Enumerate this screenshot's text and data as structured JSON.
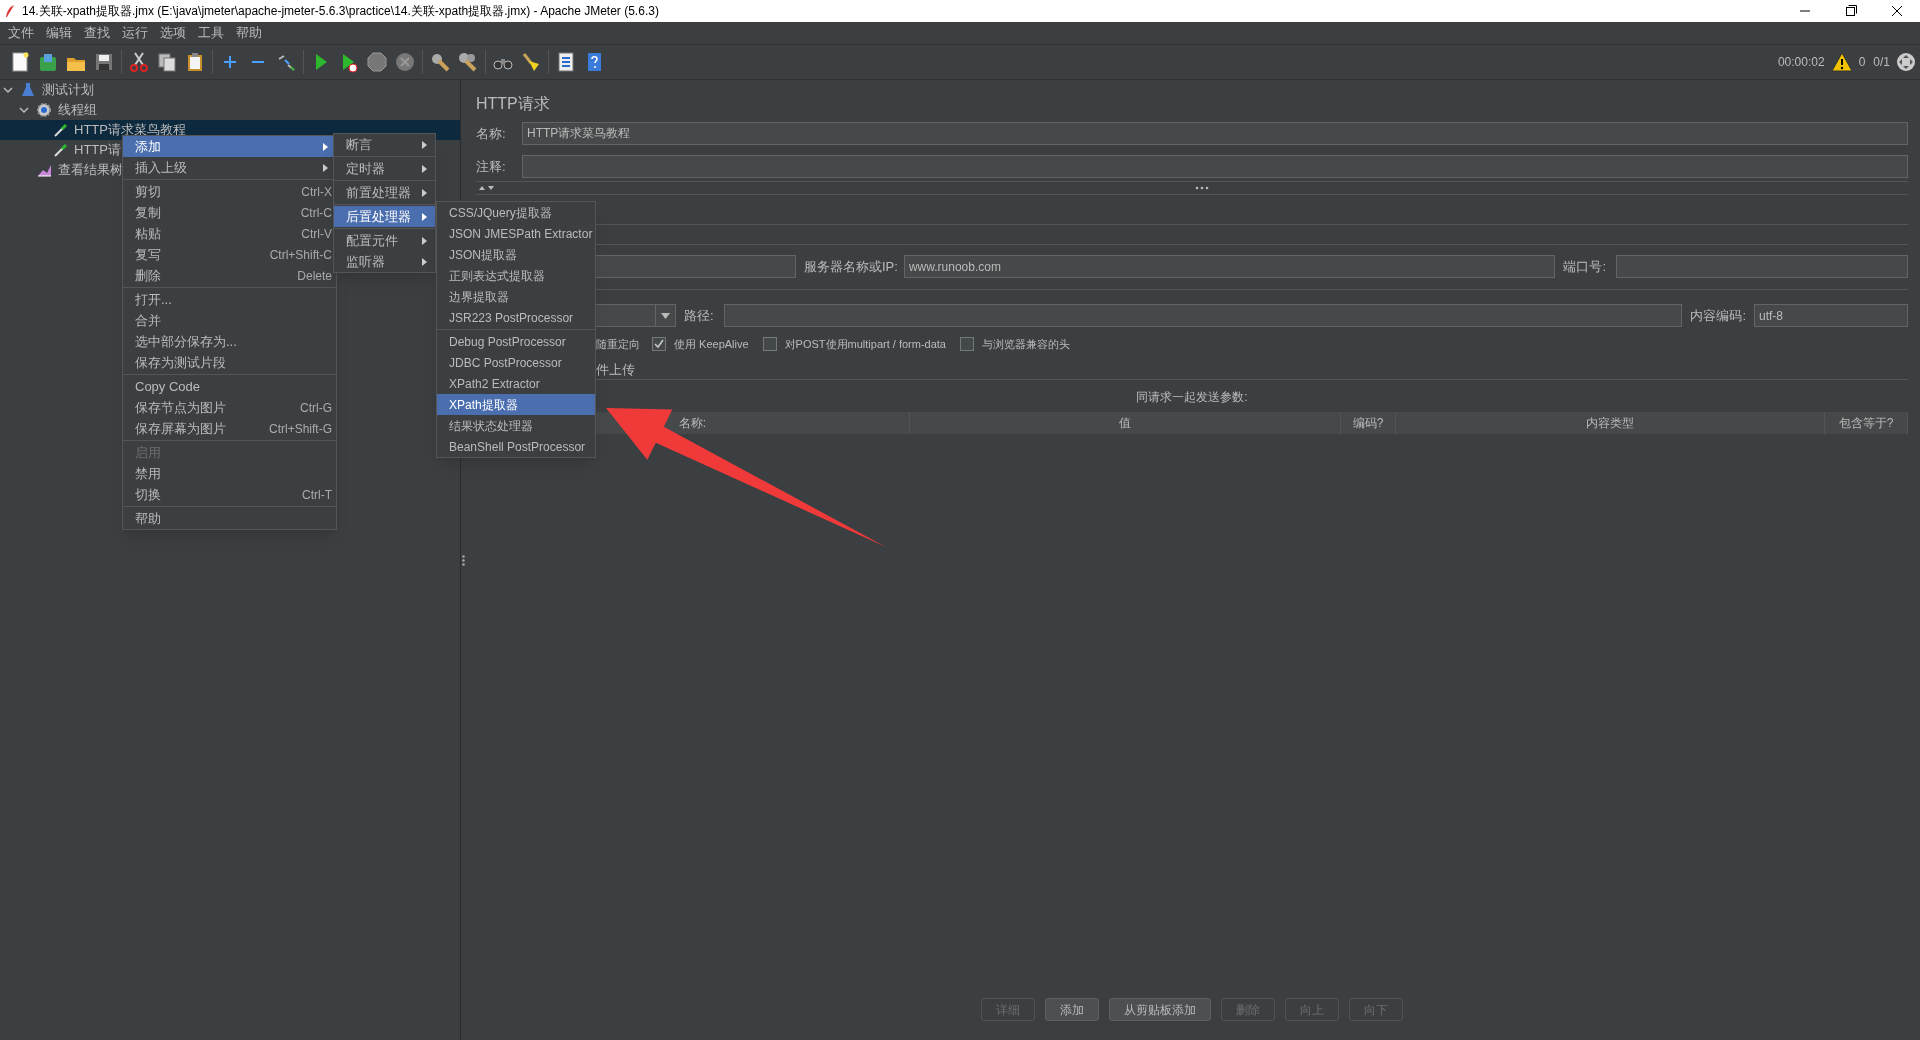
{
  "window": {
    "title": "14.关联-xpath提取器.jmx (E:\\java\\jmeter\\apache-jmeter-5.6.3\\practice\\14.关联-xpath提取器.jmx) - Apache JMeter (5.6.3)"
  },
  "menu_bar": [
    "文件",
    "编辑",
    "查找",
    "运行",
    "选项",
    "工具",
    "帮助"
  ],
  "status": {
    "elapsed": "00:00:02",
    "warnings": "0",
    "threads": "0/1"
  },
  "tree": [
    {
      "label": "测试计划",
      "kind": "test_plan",
      "expanded": true,
      "selected": false,
      "children": [
        {
          "label": "线程组",
          "kind": "thread_group",
          "expanded": true,
          "selected": false,
          "children": [
            {
              "label": "HTTP请求菜鸟教程",
              "kind": "sampler",
              "selected": true
            },
            {
              "label": "HTTP请",
              "kind": "sampler",
              "selected": false
            }
          ]
        },
        {
          "label": "查看结果树",
          "kind": "listener",
          "selected": false
        }
      ]
    }
  ],
  "context_menu": {
    "groups": [
      [
        {
          "label": "添加",
          "submenu": true,
          "selected": true,
          "disabled": false
        },
        {
          "label": "插入上级",
          "submenu": true,
          "selected": false,
          "disabled": false
        }
      ],
      [
        {
          "label": "剪切",
          "shortcut": "Ctrl-X",
          "submenu": false,
          "selected": false,
          "disabled": false
        },
        {
          "label": "复制",
          "shortcut": "Ctrl-C",
          "submenu": false,
          "selected": false,
          "disabled": false
        },
        {
          "label": "粘贴",
          "shortcut": "Ctrl-V",
          "submenu": false,
          "selected": false,
          "disabled": false
        },
        {
          "label": "复写",
          "shortcut": "Ctrl+Shift-C",
          "submenu": false,
          "selected": false,
          "disabled": false
        },
        {
          "label": "删除",
          "shortcut": "Delete",
          "submenu": false,
          "selected": false,
          "disabled": false
        }
      ],
      [
        {
          "label": "打开...",
          "submenu": false,
          "selected": false,
          "disabled": false
        },
        {
          "label": "合并",
          "submenu": false,
          "selected": false,
          "disabled": false
        },
        {
          "label": "选中部分保存为...",
          "submenu": false,
          "selected": false,
          "disabled": false
        },
        {
          "label": "保存为测试片段",
          "submenu": false,
          "selected": false,
          "disabled": false
        }
      ],
      [
        {
          "label": "Copy Code",
          "submenu": false,
          "selected": false,
          "disabled": false
        },
        {
          "label": "保存节点为图片",
          "shortcut": "Ctrl-G",
          "submenu": false,
          "selected": false,
          "disabled": false
        },
        {
          "label": "保存屏幕为图片",
          "shortcut": "Ctrl+Shift-G",
          "submenu": false,
          "selected": false,
          "disabled": false
        }
      ],
      [
        {
          "label": "启用",
          "submenu": false,
          "selected": false,
          "disabled": true
        },
        {
          "label": "禁用",
          "submenu": false,
          "selected": false,
          "disabled": false
        },
        {
          "label": "切换",
          "shortcut": "Ctrl-T",
          "submenu": false,
          "selected": false,
          "disabled": false
        }
      ],
      [
        {
          "label": "帮助",
          "submenu": false,
          "selected": false,
          "disabled": false
        }
      ]
    ]
  },
  "add_submenu": {
    "groups": [
      [
        {
          "label": "断言",
          "submenu": true,
          "selected": false,
          "disabled": false
        }
      ],
      [
        {
          "label": "定时器",
          "submenu": true,
          "selected": false,
          "disabled": false
        }
      ],
      [
        {
          "label": "前置处理器",
          "submenu": true,
          "selected": false,
          "disabled": false
        }
      ],
      [
        {
          "label": "后置处理器",
          "submenu": true,
          "selected": true,
          "disabled": false
        }
      ],
      [
        {
          "label": "配置元件",
          "submenu": true,
          "selected": false,
          "disabled": false
        },
        {
          "label": "监听器",
          "submenu": true,
          "selected": false,
          "disabled": false
        }
      ]
    ]
  },
  "post_processor_submenu": {
    "groups": [
      [
        {
          "label": "CSS/JQuery提取器",
          "submenu": false,
          "selected": false,
          "disabled": false
        },
        {
          "label": "JSON JMESPath Extractor",
          "submenu": false,
          "selected": false,
          "disabled": false
        },
        {
          "label": "JSON提取器",
          "submenu": false,
          "selected": false,
          "disabled": false
        },
        {
          "label": "正则表达式提取器",
          "submenu": false,
          "selected": false,
          "disabled": false
        },
        {
          "label": "边界提取器",
          "submenu": false,
          "selected": false,
          "disabled": false
        },
        {
          "label": "JSR223 PostProcessor",
          "submenu": false,
          "selected": false,
          "disabled": false
        }
      ],
      [
        {
          "label": "Debug PostProcessor",
          "submenu": false,
          "selected": false,
          "disabled": false
        },
        {
          "label": "JDBC PostProcessor",
          "submenu": false,
          "selected": false,
          "disabled": false
        },
        {
          "label": "XPath2 Extractor",
          "submenu": false,
          "selected": false,
          "disabled": false
        },
        {
          "label": "XPath提取器",
          "submenu": false,
          "selected": true,
          "disabled": false
        },
        {
          "label": "结果状态处理器",
          "submenu": false,
          "selected": false,
          "disabled": false
        },
        {
          "label": "BeanShell PostProcessor",
          "submenu": false,
          "selected": false,
          "disabled": false
        }
      ]
    ]
  },
  "panel": {
    "title": "HTTP请求",
    "name_label": "名称:",
    "name_value": "HTTP请求菜鸟教程",
    "comment_label": "注释:",
    "server_label": "服务器名称或IP:",
    "server_value": "www.runoob.com",
    "port_label": "端口号:",
    "path_label": "路径:",
    "encoding_label": "内容编码:",
    "encoding_value": "utf-8",
    "redirect_fragment": "随重定向",
    "checkboxes": [
      {
        "label": "使用 KeepAlive",
        "checked": true
      },
      {
        "label": "对POST使用multipart / form-data",
        "checked": false
      },
      {
        "label": "与浏览器兼容的头",
        "checked": false
      }
    ],
    "upload_fragment": "件上传",
    "params_caption": "同请求一起发送参数:",
    "table": {
      "columns": [
        "名称:",
        "值",
        "编码?",
        "内容类型",
        "包含等于?"
      ]
    },
    "buttons": [
      {
        "label": "详细",
        "disabled": true
      },
      {
        "label": "添加",
        "disabled": false
      },
      {
        "label": "从剪贴板添加",
        "disabled": false
      },
      {
        "label": "删除",
        "disabled": true
      },
      {
        "label": "向上",
        "disabled": true
      },
      {
        "label": "向下",
        "disabled": true
      }
    ]
  }
}
